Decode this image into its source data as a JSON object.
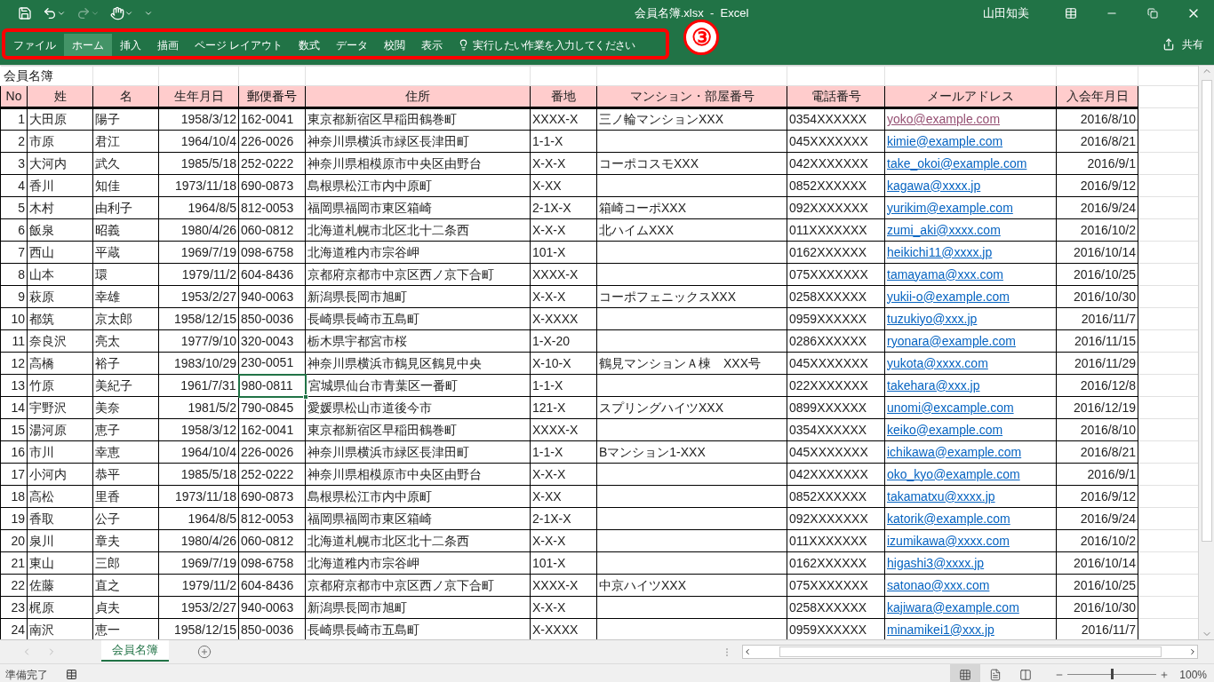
{
  "window": {
    "title": "会員名簿.xlsx  -  Excel",
    "user": "山田知美"
  },
  "quick_access": {
    "redo_disabled": true
  },
  "ribbon_tabs": [
    {
      "label": "ファイル",
      "selected": false
    },
    {
      "label": "ホーム",
      "selected": true
    },
    {
      "label": "挿入",
      "selected": false
    },
    {
      "label": "描画",
      "selected": false
    },
    {
      "label": "ページ レイアウト",
      "selected": false
    },
    {
      "label": "数式",
      "selected": false
    },
    {
      "label": "データ",
      "selected": false
    },
    {
      "label": "校閲",
      "selected": false
    },
    {
      "label": "表示",
      "selected": false
    }
  ],
  "tell_me": {
    "placeholder": "実行したい作業を入力してください"
  },
  "share": {
    "label": "共有"
  },
  "annotation": {
    "label": "③"
  },
  "sheet": {
    "title": "会員名簿",
    "columns": [
      {
        "label": "No",
        "selected": false
      },
      {
        "label": "姓",
        "selected": false
      },
      {
        "label": "名",
        "selected": false
      },
      {
        "label": "生年月日",
        "selected": false
      },
      {
        "label": "郵便番号",
        "selected": true
      },
      {
        "label": "住所",
        "selected": false
      },
      {
        "label": "番地",
        "selected": false
      },
      {
        "label": "マンション・部屋番号",
        "selected": false
      },
      {
        "label": "電話番号",
        "selected": false
      },
      {
        "label": "メールアドレス",
        "selected": false
      },
      {
        "label": "入会年月日",
        "selected": false
      }
    ],
    "rows": [
      {
        "cells": [
          "1",
          "大田原",
          "陽子",
          "1958/3/12",
          "162-0041",
          "東京都新宿区早稲田鶴巻町",
          "XXXX-X",
          "三ノ輪マンションXXX",
          "0354XXXXXX",
          "yoko@example.com",
          "2016/8/10"
        ],
        "email_visited": true,
        "selected": false
      },
      {
        "cells": [
          "2",
          "市原",
          "君江",
          "1964/10/4",
          "226-0026",
          "神奈川県横浜市緑区長津田町",
          "1-1-X",
          null,
          "045XXXXXXX",
          "kimie@example.com",
          "2016/8/21"
        ],
        "email_visited": false,
        "selected": false
      },
      {
        "cells": [
          "3",
          "大河内",
          "武久",
          "1985/5/18",
          "252-0222",
          "神奈川県相模原市中央区由野台",
          "X-X-X",
          "コーポコスモXXX",
          "042XXXXXXX",
          "take_okoi@example.com",
          "2016/9/1"
        ],
        "email_visited": false,
        "selected": false
      },
      {
        "cells": [
          "4",
          "香川",
          "知佳",
          "1973/11/18",
          "690-0873",
          "島根県松江市内中原町",
          "X-XX",
          null,
          "0852XXXXXX",
          "kagawa@xxxx.jp",
          "2016/9/12"
        ],
        "email_visited": false,
        "selected": false
      },
      {
        "cells": [
          "5",
          "木村",
          "由利子",
          "1964/8/5",
          "812-0053",
          "福岡県福岡市東区箱崎",
          "2-1X-X",
          "箱崎コーポXXX",
          "092XXXXXXX",
          "yurikim@example.com",
          "2016/9/24"
        ],
        "email_visited": false,
        "selected": false
      },
      {
        "cells": [
          "6",
          "飯泉",
          "昭義",
          "1980/4/26",
          "060-0812",
          "北海道札幌市北区北十二条西",
          "X-X-X",
          "北ハイムXXX",
          "011XXXXXXX",
          "zumi_aki@xxxx.com",
          "2016/10/2"
        ],
        "email_visited": false,
        "selected": false
      },
      {
        "cells": [
          "7",
          "西山",
          "平蔵",
          "1969/7/19",
          "098-6758",
          "北海道稚内市宗谷岬",
          "101-X",
          null,
          "0162XXXXXX",
          "heikichi11@xxxx.jp",
          "2016/10/14"
        ],
        "email_visited": false,
        "selected": false
      },
      {
        "cells": [
          "8",
          "山本",
          "環",
          "1979/11/2",
          "604-8436",
          "京都府京都市中京区西ノ京下合町",
          "XXXX-X",
          null,
          "075XXXXXXX",
          "tamayama@xxx.com",
          "2016/10/25"
        ],
        "email_visited": false,
        "selected": false
      },
      {
        "cells": [
          "9",
          "萩原",
          "幸雄",
          "1953/2/27",
          "940-0063",
          "新潟県長岡市旭町",
          "X-X-X",
          "コーポフェニックスXXX",
          "0258XXXXXX",
          "yukii-o@example.com",
          "2016/10/30"
        ],
        "email_visited": false,
        "selected": false
      },
      {
        "cells": [
          "10",
          "都筑",
          "京太郎",
          "1958/12/15",
          "850-0036",
          "長崎県長崎市五島町",
          "X-XXXX",
          null,
          "0959XXXXXX",
          "tuzukiyo@xxx.jp",
          "2016/11/7"
        ],
        "email_visited": false,
        "selected": false
      },
      {
        "cells": [
          "11",
          "奈良沢",
          "亮太",
          "1977/9/10",
          "320-0043",
          "栃木県宇都宮市桜",
          "1-X-20",
          null,
          "0286XXXXXX",
          "ryonara@example.com",
          "2016/11/15"
        ],
        "email_visited": false,
        "selected": false
      },
      {
        "cells": [
          "12",
          "高橋",
          "裕子",
          "1983/10/29",
          "230-0051",
          "神奈川県横浜市鶴見区鶴見中央",
          "X-10-X",
          "鶴見マンションＡ棟　XXX号",
          "045XXXXXXX",
          "yukota@xxxx.com",
          "2016/11/29"
        ],
        "email_visited": false,
        "selected": false
      },
      {
        "cells": [
          "13",
          "竹原",
          "美紀子",
          "1961/7/31",
          "980-0811",
          "宮城県仙台市青葉区一番町",
          "1-1-X",
          null,
          "022XXXXXXX",
          "takehara@xxx.jp",
          "2016/12/8"
        ],
        "email_visited": false,
        "selected": true
      },
      {
        "cells": [
          "14",
          "宇野沢",
          "美奈",
          "1981/5/2",
          "790-0845",
          "愛媛県松山市道後今市",
          "121-X",
          "スプリングハイツXXX",
          "0899XXXXXX",
          "unomi@excample.com",
          "2016/12/19"
        ],
        "email_visited": false,
        "selected": false
      },
      {
        "cells": [
          "15",
          "湯河原",
          "恵子",
          "1958/3/12",
          "162-0041",
          "東京都新宿区早稲田鶴巻町",
          "XXXX-X",
          null,
          "0354XXXXXX",
          "keiko@example.com",
          "2016/8/10"
        ],
        "email_visited": false,
        "selected": false
      },
      {
        "cells": [
          "16",
          "市川",
          "幸恵",
          "1964/10/4",
          "226-0026",
          "神奈川県横浜市緑区長津田町",
          "1-1-X",
          "Bマンション1-XXX",
          "045XXXXXXX",
          "ichikawa@example.com",
          "2016/8/21"
        ],
        "email_visited": false,
        "selected": false
      },
      {
        "cells": [
          "17",
          "小河内",
          "恭平",
          "1985/5/18",
          "252-0222",
          "神奈川県相模原市中央区由野台",
          "X-X-X",
          null,
          "042XXXXXXX",
          "oko_kyo@example.com",
          "2016/9/1"
        ],
        "email_visited": false,
        "selected": false
      },
      {
        "cells": [
          "18",
          "高松",
          "里香",
          "1973/11/18",
          "690-0873",
          "島根県松江市内中原町",
          "X-XX",
          null,
          "0852XXXXXX",
          "takamatxu@xxxx.jp",
          "2016/9/12"
        ],
        "email_visited": false,
        "selected": false
      },
      {
        "cells": [
          "19",
          "香取",
          "公子",
          "1964/8/5",
          "812-0053",
          "福岡県福岡市東区箱崎",
          "2-1X-X",
          null,
          "092XXXXXXX",
          "katorik@example.com",
          "2016/9/24"
        ],
        "email_visited": false,
        "selected": false
      },
      {
        "cells": [
          "20",
          "泉川",
          "章夫",
          "1980/4/26",
          "060-0812",
          "北海道札幌市北区北十二条西",
          "X-X-X",
          null,
          "011XXXXXXX",
          "izumikawa@xxxx.com",
          "2016/10/2"
        ],
        "email_visited": false,
        "selected": false
      },
      {
        "cells": [
          "21",
          "東山",
          "三郎",
          "1969/7/19",
          "098-6758",
          "北海道稚内市宗谷岬",
          "101-X",
          null,
          "0162XXXXXX",
          "higashi3@xxxx.jp",
          "2016/10/14"
        ],
        "email_visited": false,
        "selected": false
      },
      {
        "cells": [
          "22",
          "佐藤",
          "直之",
          "1979/11/2",
          "604-8436",
          "京都府京都市中京区西ノ京下合町",
          "XXXX-X",
          "中京ハイツXXX",
          "075XXXXXXX",
          "satonao@xxx.com",
          "2016/10/25"
        ],
        "email_visited": false,
        "selected": false
      },
      {
        "cells": [
          "23",
          "梶原",
          "貞夫",
          "1953/2/27",
          "940-0063",
          "新潟県長岡市旭町",
          "X-X-X",
          null,
          "0258XXXXXX",
          "kajiwara@example.com",
          "2016/10/30"
        ],
        "email_visited": false,
        "selected": false
      },
      {
        "cells": [
          "24",
          "南沢",
          "恵一",
          "1958/12/15",
          "850-0036",
          "長崎県長崎市五島町",
          "X-XXXX",
          null,
          "0959XXXXXX",
          "minamikei1@xxx.jp",
          "2016/11/7"
        ],
        "email_visited": false,
        "selected": false
      }
    ]
  },
  "sheet_tabs": [
    {
      "label": "会員名簿",
      "selected": true
    }
  ],
  "status_bar": {
    "status": "準備完了",
    "views": [
      {
        "kind": "normal",
        "selected": true
      },
      {
        "kind": "page-layout",
        "selected": false
      },
      {
        "kind": "page-break",
        "selected": false
      }
    ],
    "zoom": {
      "level": 0.5,
      "label": "100%"
    }
  }
}
